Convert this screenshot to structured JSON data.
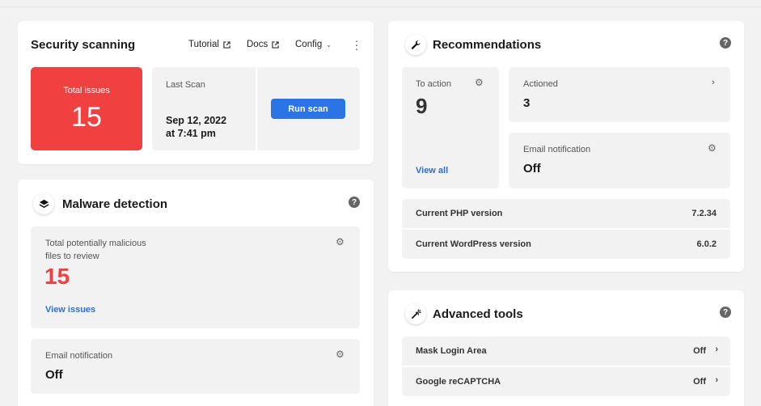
{
  "security": {
    "title": "Security scanning",
    "links": {
      "tutorial": "Tutorial",
      "docs": "Docs",
      "config": "Config"
    },
    "total_issues_label": "Total issues",
    "total_issues_value": "15",
    "last_scan_label": "Last Scan",
    "last_scan_date": "Sep 12, 2022",
    "last_scan_time": "at 7:41 pm",
    "run_scan_label": "Run scan"
  },
  "malware": {
    "title": "Malware detection",
    "files_label_line1": "Total potentially malicious",
    "files_label_line2": "files to review",
    "files_value": "15",
    "view_issues": "View issues",
    "email_label": "Email notification",
    "email_value": "Off"
  },
  "recommendations": {
    "title": "Recommendations",
    "to_action_label": "To action",
    "to_action_value": "9",
    "view_all": "View all",
    "actioned_label": "Actioned",
    "actioned_value": "3",
    "email_label": "Email notification",
    "email_value": "Off",
    "rows": [
      {
        "label": "Current PHP version",
        "value": "7.2.34"
      },
      {
        "label": "Current WordPress version",
        "value": "6.0.2"
      }
    ]
  },
  "advanced": {
    "title": "Advanced tools",
    "rows": [
      {
        "label": "Mask Login Area",
        "value": "Off"
      },
      {
        "label": "Google reCAPTCHA",
        "value": "Off"
      }
    ]
  },
  "colors": {
    "danger": "#f04040",
    "accent": "#2b74e6",
    "link": "#2b6fd6"
  }
}
